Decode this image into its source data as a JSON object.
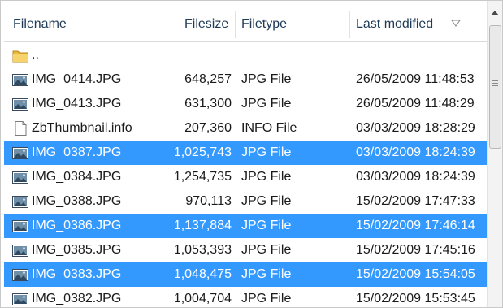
{
  "columns": {
    "filename": "Filename",
    "filesize": "Filesize",
    "filetype": "Filetype",
    "last_modified": "Last modified"
  },
  "rows": [
    {
      "name": "..",
      "size": "",
      "type": "",
      "modified": "",
      "icon": "folder-icon",
      "selected": false
    },
    {
      "name": "IMG_0414.JPG",
      "size": "648,257",
      "type": "JPG File",
      "modified": "26/05/2009 11:48:53",
      "icon": "image-file-icon",
      "selected": false
    },
    {
      "name": "IMG_0413.JPG",
      "size": "631,300",
      "type": "JPG File",
      "modified": "26/05/2009 11:48:29",
      "icon": "image-file-icon",
      "selected": false
    },
    {
      "name": "ZbThumbnail.info",
      "size": "207,360",
      "type": "INFO File",
      "modified": "03/03/2009 18:28:29",
      "icon": "document-file-icon",
      "selected": false
    },
    {
      "name": "IMG_0387.JPG",
      "size": "1,025,743",
      "type": "JPG File",
      "modified": "03/03/2009 18:24:39",
      "icon": "image-file-icon",
      "selected": true
    },
    {
      "name": "IMG_0384.JPG",
      "size": "1,254,735",
      "type": "JPG File",
      "modified": "03/03/2009 18:24:39",
      "icon": "image-file-icon",
      "selected": false
    },
    {
      "name": "IMG_0388.JPG",
      "size": "970,113",
      "type": "JPG File",
      "modified": "15/02/2009 17:47:33",
      "icon": "image-file-icon",
      "selected": false
    },
    {
      "name": "IMG_0386.JPG",
      "size": "1,137,884",
      "type": "JPG File",
      "modified": "15/02/2009 17:46:14",
      "icon": "image-file-icon",
      "selected": true
    },
    {
      "name": "IMG_0385.JPG",
      "size": "1,053,393",
      "type": "JPG File",
      "modified": "15/02/2009 17:45:16",
      "icon": "image-file-icon",
      "selected": false
    },
    {
      "name": "IMG_0383.JPG",
      "size": "1,048,475",
      "type": "JPG File",
      "modified": "15/02/2009 15:54:05",
      "icon": "image-file-icon",
      "selected": true
    },
    {
      "name": "IMG_0382.JPG",
      "size": "1,004,704",
      "type": "JPG File",
      "modified": "15/02/2009 15:53:45",
      "icon": "image-file-icon",
      "selected": false
    }
  ],
  "sort": {
    "column": "last_modified",
    "direction": "descending",
    "indicator": "sort-descending-icon"
  },
  "colors": {
    "selection": "#3399ff",
    "header_text": "#1e3a57"
  }
}
